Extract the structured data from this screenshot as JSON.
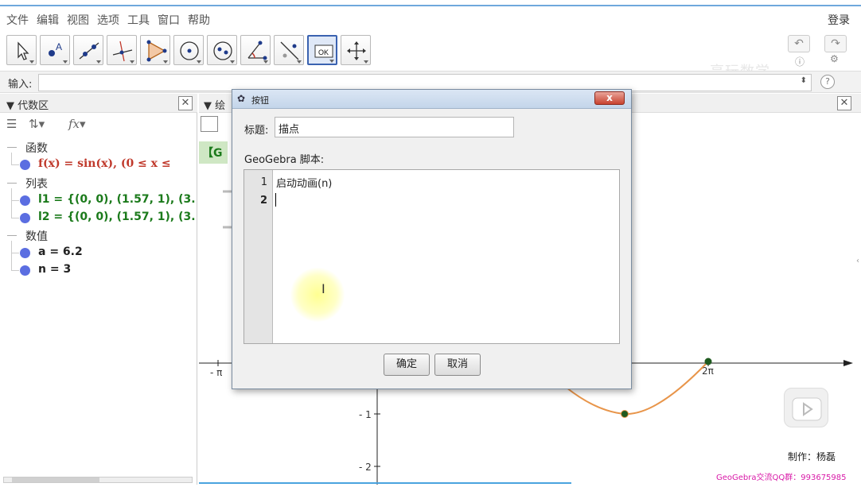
{
  "menu": {
    "items": [
      "文件",
      "编辑",
      "视图",
      "选项",
      "工具",
      "窗口",
      "帮助"
    ],
    "login": "登录"
  },
  "toolbar": {
    "tools": [
      "move-tool",
      "point-tool",
      "line-tool",
      "perpendicular-tool",
      "polygon-tool",
      "circle-tool",
      "conic-tool",
      "angle-tool",
      "reflect-tool",
      "button-tool",
      "move-view-tool"
    ],
    "active_tool": "button-tool",
    "watermark": "享玩数学"
  },
  "inputbar": {
    "label": "输入:",
    "value": ""
  },
  "algebra": {
    "title": "代数区",
    "categories": [
      {
        "label": "函数",
        "items": [
          {
            "text": "f(x)  =  sin(x),     (0 ≤ x ≤",
            "color": "#c0392b"
          }
        ]
      },
      {
        "label": "列表",
        "items": [
          {
            "text": "l1 = {(0, 0), (1.57, 1), (3.14, 0",
            "color": "#1b7a1b"
          },
          {
            "text": "l2 = {(0, 0), (1.57, 1), (3.14, 0",
            "color": "#1b7a1b"
          }
        ]
      },
      {
        "label": "数值",
        "items": [
          {
            "text": "a = 6.2",
            "color": "#222222"
          },
          {
            "text": "n = 3",
            "color": "#222222"
          }
        ]
      }
    ]
  },
  "graphics": {
    "title": "绘",
    "tab_label": "【G",
    "tick_labels": [
      "- π",
      "2π",
      "- 1",
      "- 2"
    ],
    "credit": "制作：杨磊",
    "qq_group": "GeoGebra交流QQ群：993675985"
  },
  "dialog": {
    "title": "按钮",
    "close_label": "x",
    "caption_label": "标题:",
    "caption_value": "描点",
    "script_label": "GeoGebra 脚本:",
    "line_numbers": [
      "1",
      "2"
    ],
    "code_lines": [
      "启动动画(n)",
      ""
    ],
    "ok_label": "确定",
    "cancel_label": "取消"
  },
  "colors": {
    "curve": "#e8954a",
    "point": "#1f5a1f",
    "accent": "#3a62b0"
  }
}
